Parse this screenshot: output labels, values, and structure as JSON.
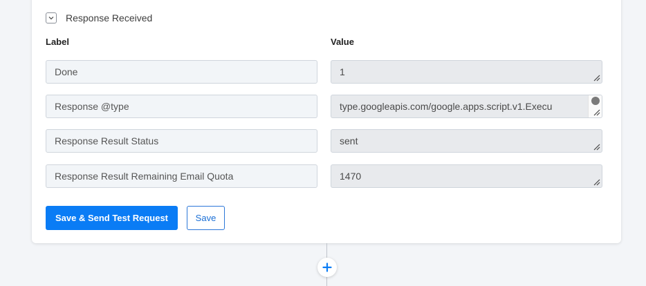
{
  "section": {
    "title": "Response Received",
    "toggle_icon": "chevron-down-icon"
  },
  "columns": {
    "label": "Label",
    "value": "Value"
  },
  "rows": [
    {
      "label": "Done",
      "value": "1"
    },
    {
      "label": "Response @type",
      "value": "type.googleapis.com/google.apps.script.v1.Execu"
    },
    {
      "label": "Response Result Status",
      "value": "sent"
    },
    {
      "label": "Response Result Remaining Email Quota",
      "value": "1470"
    }
  ],
  "buttons": {
    "save_send": "Save & Send Test Request",
    "save": "Save"
  },
  "add_step_icon": "plus-icon",
  "colors": {
    "primary": "#0a7cf5",
    "background": "#f3f5f8",
    "card": "#ffffff"
  }
}
